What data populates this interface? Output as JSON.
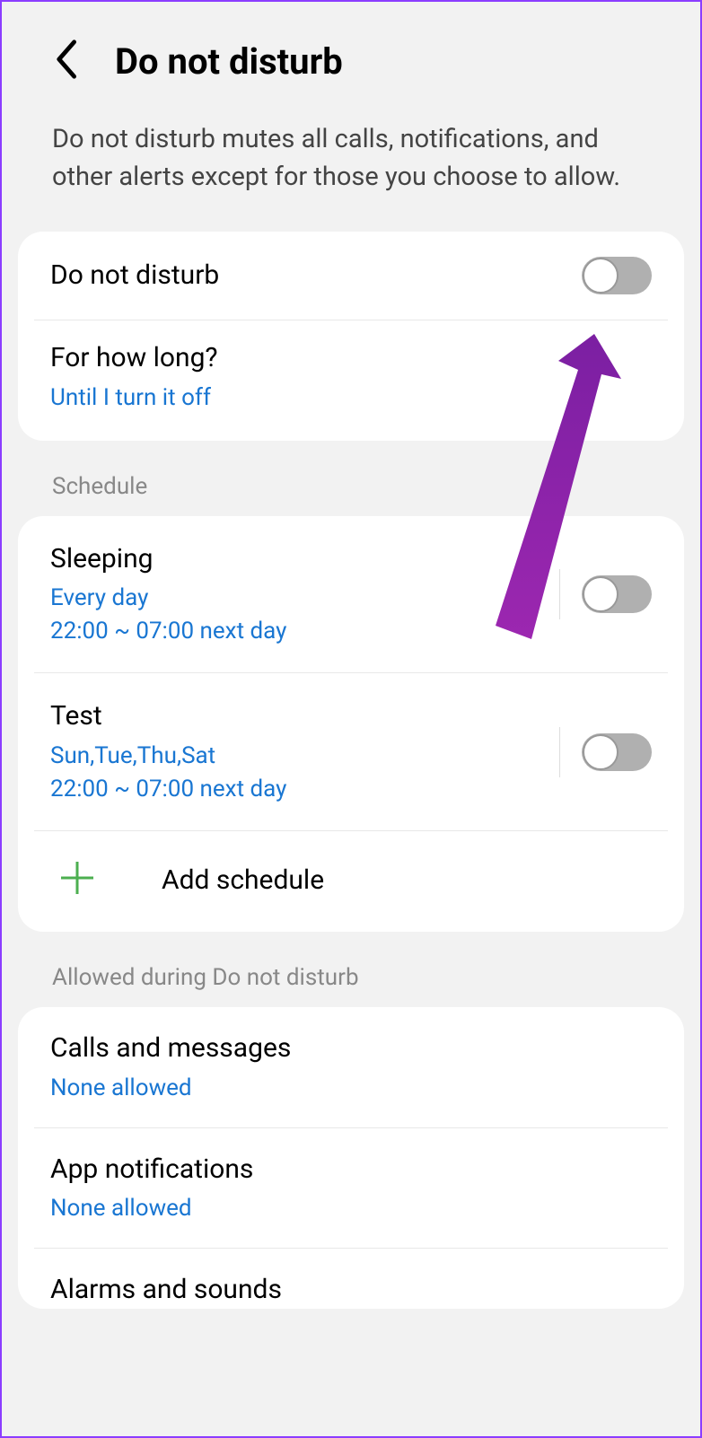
{
  "header": {
    "title": "Do not disturb"
  },
  "description": "Do not disturb mutes all calls, notifications, and other alerts except for those you choose to allow.",
  "mainToggle": {
    "label": "Do not disturb",
    "enabled": false
  },
  "duration": {
    "label": "For how long?",
    "value": "Until I turn it off"
  },
  "sections": {
    "schedule": {
      "header": "Schedule",
      "items": [
        {
          "title": "Sleeping",
          "days": "Every day",
          "time": "22:00 ~ 07:00 next day",
          "enabled": false
        },
        {
          "title": "Test",
          "days": "Sun,Tue,Thu,Sat",
          "time": "22:00 ~ 07:00 next day",
          "enabled": false
        }
      ],
      "addLabel": "Add schedule"
    },
    "allowed": {
      "header": "Allowed during Do not disturb",
      "items": [
        {
          "title": "Calls and messages",
          "sub": "None allowed"
        },
        {
          "title": "App notifications",
          "sub": "None allowed"
        },
        {
          "title": "Alarms and sounds",
          "sub": ""
        }
      ]
    }
  }
}
